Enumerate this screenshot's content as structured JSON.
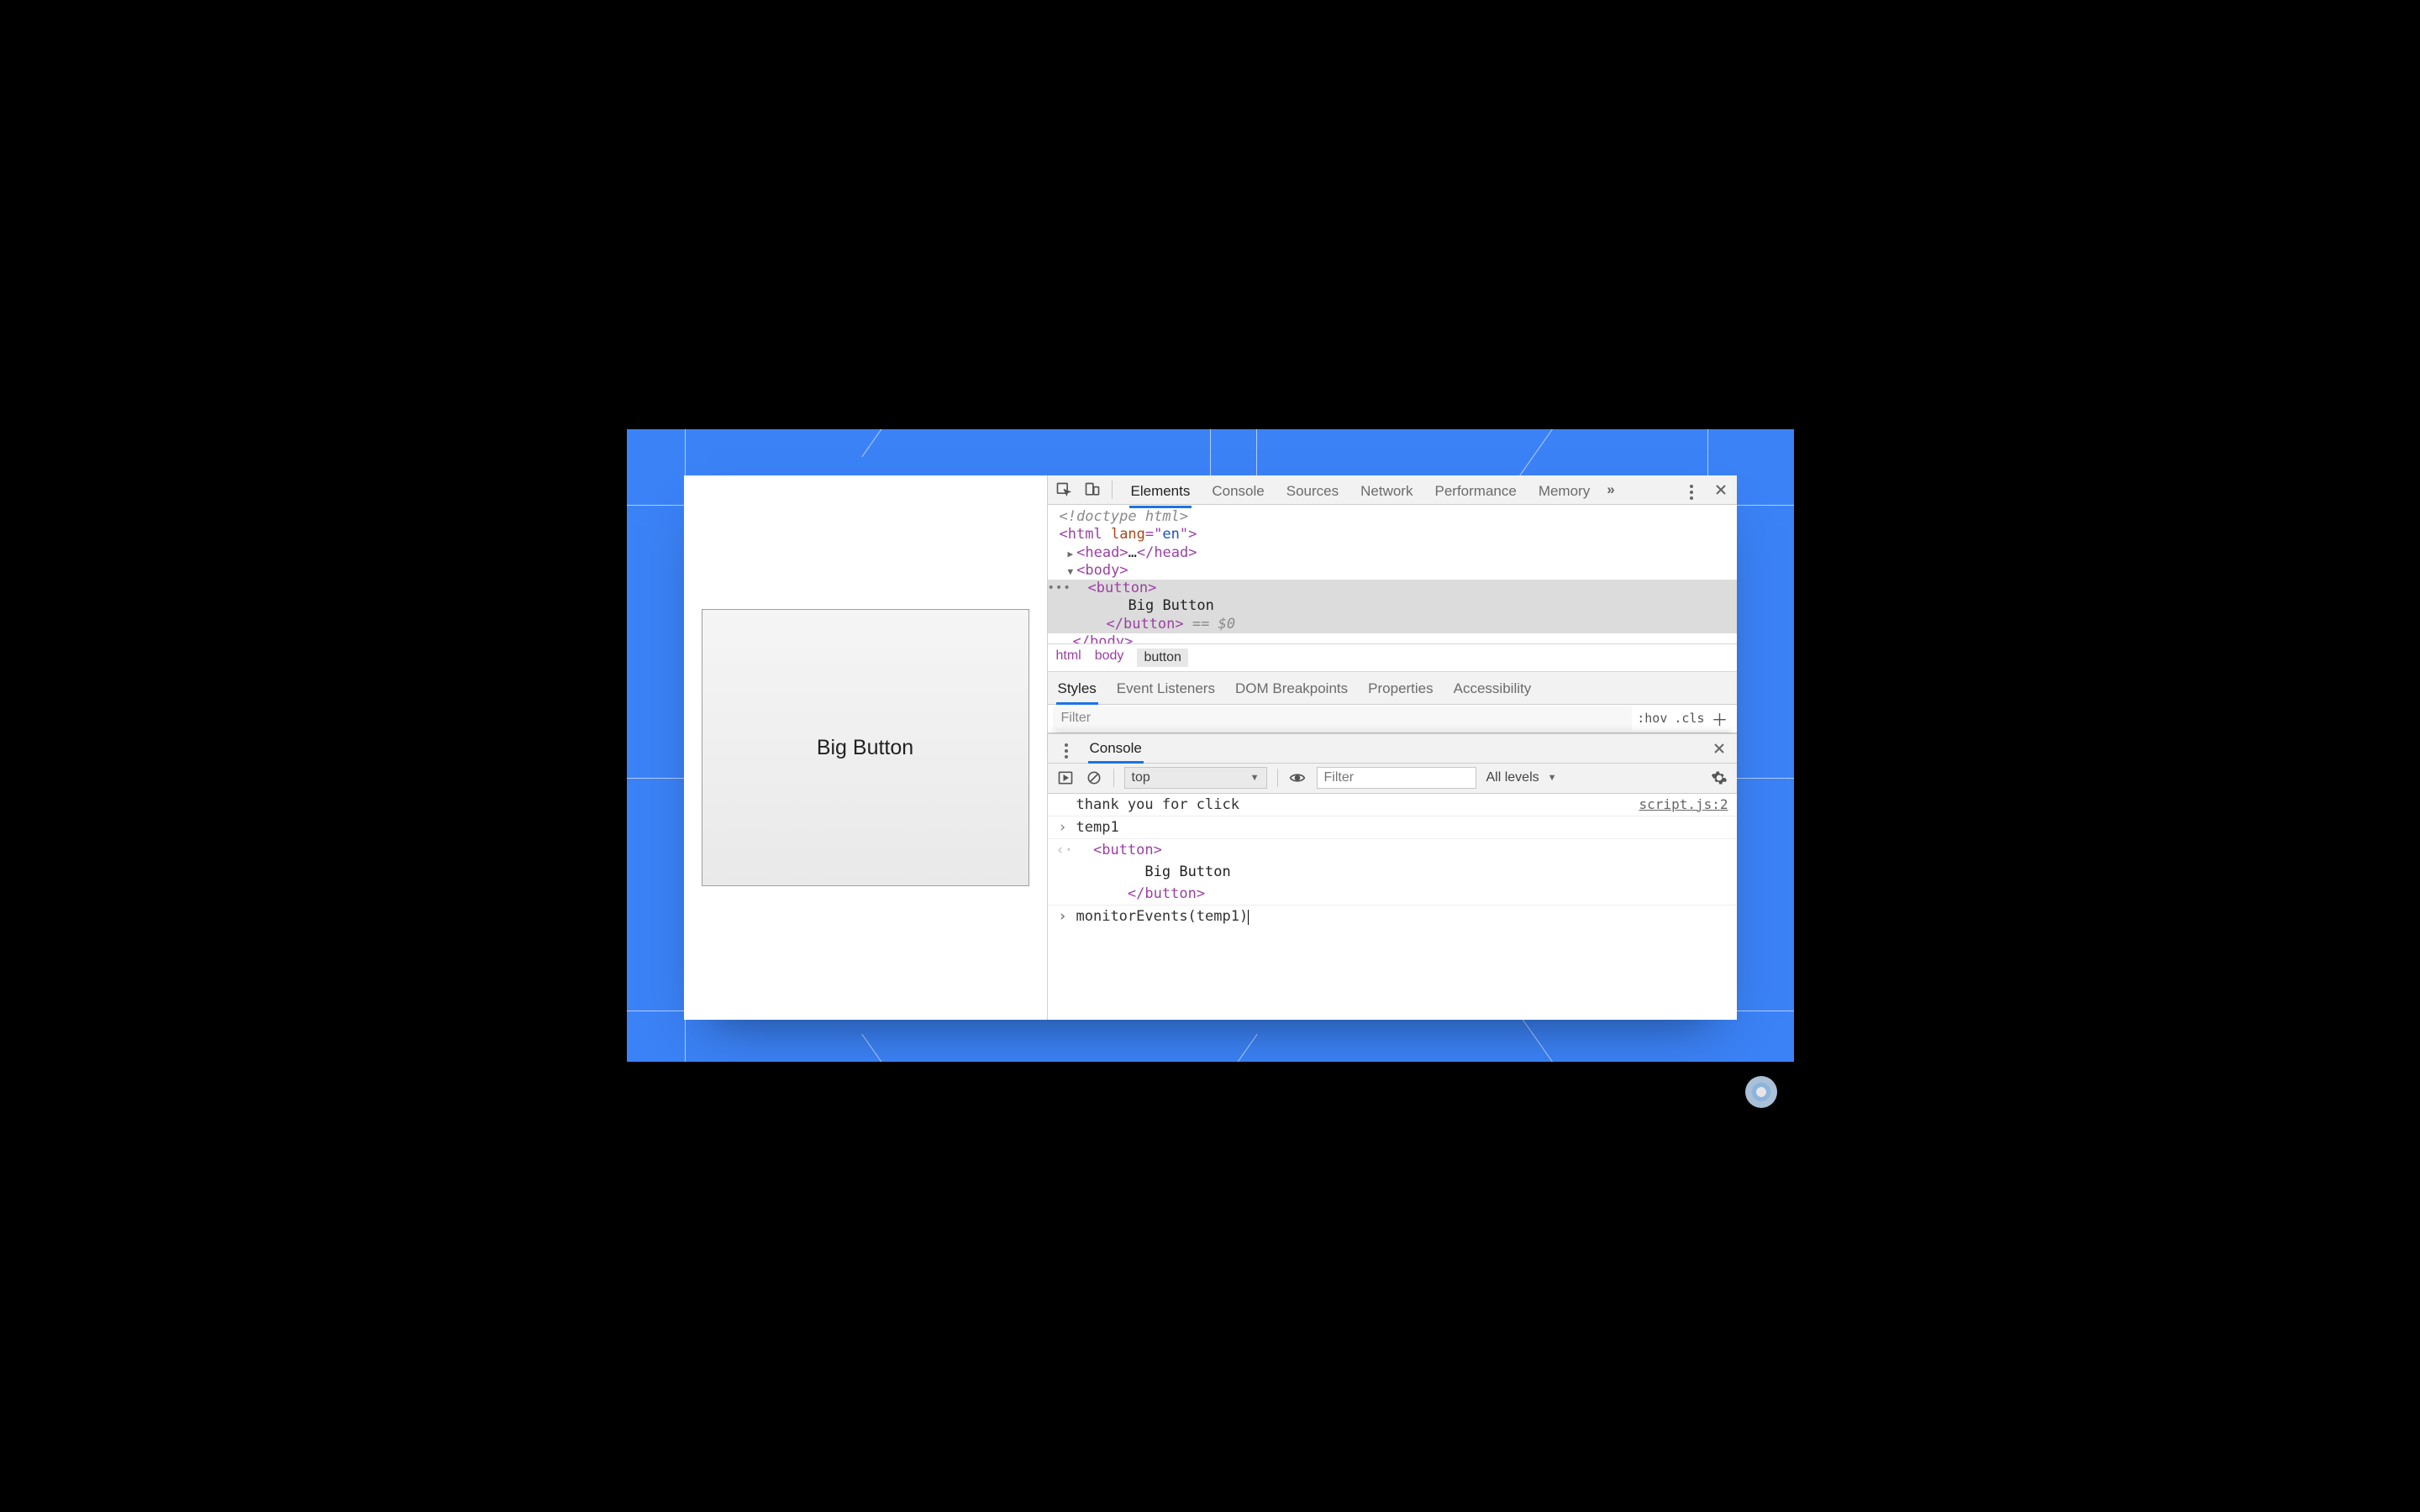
{
  "page": {
    "big_button_label": "Big Button"
  },
  "devtools": {
    "tabs": {
      "elements": "Elements",
      "console": "Console",
      "sources": "Sources",
      "network": "Network",
      "performance": "Performance",
      "memory": "Memory",
      "overflow": "»"
    },
    "dom": {
      "doctype": "<!doctype html>",
      "html_open": "<html lang=\"en\">",
      "head_collapsed": "<head>…</head>",
      "body_open": "<body>",
      "button_open": "<button>",
      "button_text": "Big Button",
      "button_close": "</button>",
      "equals_dollar0": " == $0",
      "body_close_partial": "</body>"
    },
    "breadcrumb": {
      "html": "html",
      "body": "body",
      "button": "button"
    },
    "styles_tabs": {
      "styles": "Styles",
      "event_listeners": "Event Listeners",
      "dom_breakpoints": "DOM Breakpoints",
      "properties": "Properties",
      "accessibility": "Accessibility"
    },
    "styles_filter_placeholder": "Filter",
    "hov_label": ":hov",
    "cls_label": ".cls",
    "drawer": {
      "title": "Console"
    },
    "console_toolbar": {
      "context": "top",
      "filter_placeholder": "Filter",
      "levels": "All levels"
    },
    "console": {
      "log_msg": "thank you for click",
      "log_source": "script.js:2",
      "input1": "temp1",
      "eval_line1": "<button>",
      "eval_line2": "Big Button",
      "eval_line3": "</button>",
      "input2": "monitorEvents(temp1)"
    }
  }
}
